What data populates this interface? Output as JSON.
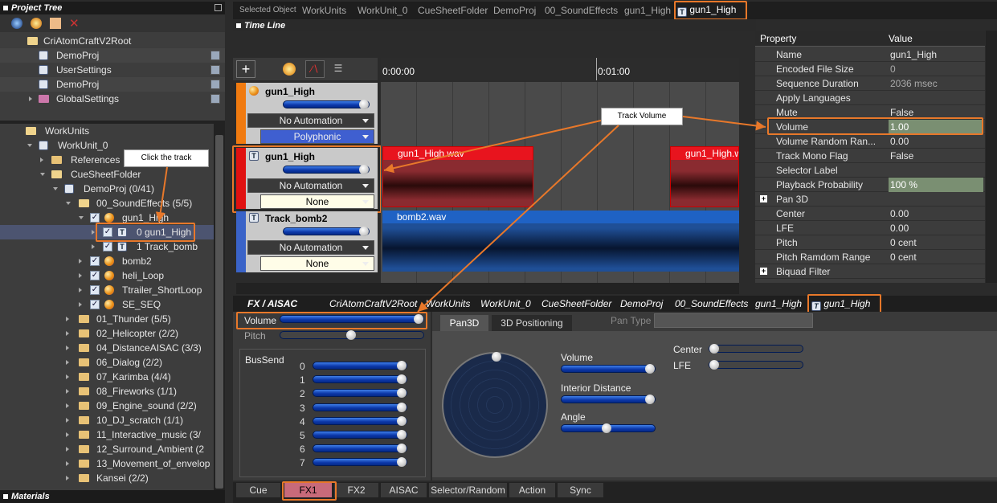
{
  "project_tree": {
    "title": "Project Tree",
    "items": [
      {
        "label": "CriAtomCraftV2Root"
      },
      {
        "label": "DemoProj"
      },
      {
        "label": "UserSettings"
      },
      {
        "label": "DemoProj"
      },
      {
        "label": "GlobalSettings"
      }
    ]
  },
  "workunits": {
    "items": [
      {
        "label": "WorkUnits"
      },
      {
        "label": "WorkUnit_0"
      },
      {
        "label": "References"
      },
      {
        "label": "CueSheetFolder"
      },
      {
        "label": "DemoProj  (0/41)"
      },
      {
        "label": "00_SoundEffects  (5/5)"
      },
      {
        "label": "gun1_High"
      },
      {
        "label": "0  gun1_High"
      },
      {
        "label": "1  Track_bomb"
      },
      {
        "label": "bomb2"
      },
      {
        "label": "heli_Loop"
      },
      {
        "label": "Ttrailer_ShortLoop"
      },
      {
        "label": "SE_SEQ"
      },
      {
        "label": "01_Thunder  (5/5)"
      },
      {
        "label": "02_Helicopter  (2/2)"
      },
      {
        "label": "04_DistanceAISAC  (3/3)"
      },
      {
        "label": "06_Dialog  (2/2)"
      },
      {
        "label": "07_Karimba  (4/4)"
      },
      {
        "label": "08_Fireworks  (1/1)"
      },
      {
        "label": "09_Engine_sound  (2/2)"
      },
      {
        "label": "10_DJ_scratch  (1/1)"
      },
      {
        "label": "11_Interactive_music  (3/"
      },
      {
        "label": "12_Surround_Ambient  (2"
      },
      {
        "label": "13_Movement_of_envelop"
      },
      {
        "label": "Kansei  (2/2)"
      }
    ]
  },
  "materials": {
    "title": "Materials"
  },
  "breadcrumb": {
    "label": "Selected Object",
    "items": [
      "WorkUnits",
      "WorkUnit_0",
      "CueSheetFolder",
      "DemoProj",
      "00_SoundEffects",
      "gun1_High",
      "gun1_High"
    ]
  },
  "timeline": {
    "title": "Time Line",
    "time_0": "0:00:00",
    "time_1": "0:01:00",
    "tracks": [
      {
        "name": "gun1_High",
        "automation": "No Automation",
        "mode": "Polyphonic"
      },
      {
        "name": "gun1_High",
        "automation": "No Automation",
        "mode": "None",
        "wave1": "gun1_High.wav",
        "wave2": "gun1_High.w"
      },
      {
        "name": "Track_bomb2",
        "automation": "No Automation",
        "mode": "None",
        "wave1": "bomb2.wav"
      }
    ]
  },
  "properties": {
    "header_property": "Property",
    "header_value": "Value",
    "rows": [
      {
        "name": "Name",
        "value": "gun1_High"
      },
      {
        "name": "Encoded File Size",
        "value": "0"
      },
      {
        "name": "Sequence Duration",
        "value": "2036 msec"
      },
      {
        "name": "Apply Languages",
        "value": ""
      },
      {
        "name": "Mute",
        "value": "False"
      },
      {
        "name": "Volume",
        "value": "1.00"
      },
      {
        "name": "Volume Random Ran...",
        "value": "0.00"
      },
      {
        "name": "Track Mono Flag",
        "value": "False"
      },
      {
        "name": "Selector Label",
        "value": ""
      },
      {
        "name": "Playback Probability",
        "value": "100 %"
      },
      {
        "name": "Pan 3D",
        "value": ""
      },
      {
        "name": "Center",
        "value": "0.00"
      },
      {
        "name": "LFE",
        "value": "0.00"
      },
      {
        "name": "Pitch",
        "value": "0 cent"
      },
      {
        "name": "Pitch Ramdom Range",
        "value": "0 cent"
      },
      {
        "name": "Biquad Filter",
        "value": ""
      }
    ]
  },
  "fx": {
    "title": "FX / AISAC",
    "crumbs": [
      "CriAtomCraftV2Root",
      "WorkUnits",
      "WorkUnit_0",
      "CueSheetFolder",
      "DemoProj",
      "00_SoundEffects",
      "gun1_High",
      "gun1_High"
    ],
    "volume": "Volume",
    "pitch": "Pitch",
    "bussend": "BusSend",
    "bus": [
      "0",
      "1",
      "2",
      "3",
      "4",
      "5",
      "6",
      "7"
    ],
    "tab_pan3d": "Pan3D",
    "tab_3d": "3D Positioning",
    "pan_type": "Pan Type",
    "p_volume": "Volume",
    "p_interior": "Interior Distance",
    "p_angle": "Angle",
    "p_center": "Center",
    "p_lfe": "LFE"
  },
  "bottom_tabs": [
    "Cue",
    "FX1",
    "FX2",
    "AISAC",
    "Selector/Random",
    "Action",
    "Sync"
  ],
  "callouts": {
    "click_track": "Click the track",
    "track_volume": "Track Volume"
  }
}
